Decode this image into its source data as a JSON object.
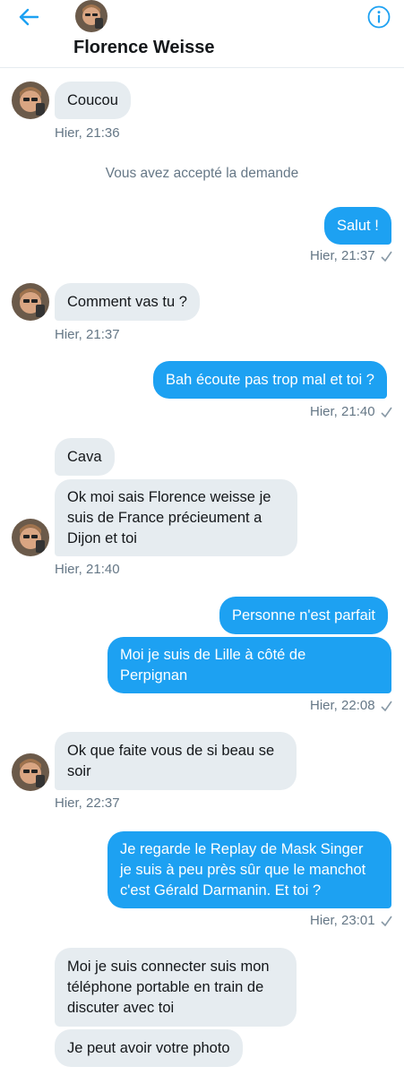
{
  "header": {
    "title": "Florence Weisse",
    "back_icon": "arrow-left-icon",
    "info_icon": "info-circle-icon",
    "accent_color": "#1da1f2"
  },
  "system": {
    "accepted": "Vous avez accepté la demande"
  },
  "messages": [
    {
      "dir": "in",
      "text": "Coucou"
    },
    {
      "dir": "in",
      "time": "Hier, 21:36"
    },
    {
      "dir": "out",
      "text": "Salut !",
      "time": "Hier, 21:37"
    },
    {
      "dir": "in",
      "text": "Comment vas tu ?",
      "time": "Hier, 21:37"
    },
    {
      "dir": "out",
      "text": "Bah écoute pas trop mal et toi ?",
      "time": "Hier, 21:40"
    },
    {
      "dir": "in",
      "text": "Cava"
    },
    {
      "dir": "in",
      "lines": [
        "Ok moi sais Florence weisse je",
        "suis de France précieument a",
        "Dijon et toi"
      ],
      "time": "Hier, 21:40"
    },
    {
      "dir": "out",
      "text": "Personne n'est parfait"
    },
    {
      "dir": "out",
      "lines": [
        "Moi je suis de Lille à côté de",
        "Perpignan"
      ],
      "time": "Hier, 22:08"
    },
    {
      "dir": "in",
      "lines": [
        "Ok que faite vous de si beau se",
        "soir"
      ],
      "time": "Hier, 22:37"
    },
    {
      "dir": "out",
      "lines": [
        "Je regarde le Replay de Mask Singer",
        "je suis à peu près sûr que le manchot",
        "c'est Gérald Darmanin. Et toi ?"
      ],
      "time": "Hier, 23:01"
    },
    {
      "dir": "in",
      "lines": [
        "Moi je suis connecter suis mon",
        "téléphone portable en train de",
        "discuter avec toi"
      ]
    },
    {
      "dir": "in",
      "text": "Je peut avoir votre photo"
    }
  ]
}
